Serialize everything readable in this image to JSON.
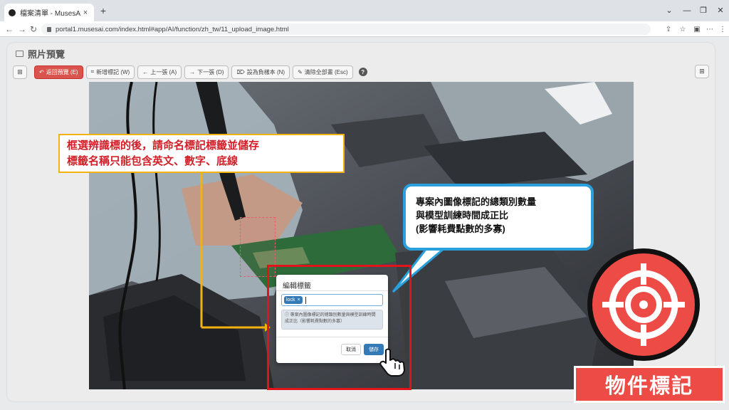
{
  "browser": {
    "tab_title": "檔案清單 - MusesAI",
    "tab_close": "×",
    "new_tab": "+",
    "url": "portal1.musesai.com/index.html#app/AI/function/zh_tw/11_upload_image.html",
    "window_controls": [
      "⌄",
      "—",
      "❐",
      "✕"
    ],
    "nav": [
      "←",
      "→",
      "↻"
    ],
    "right_icons": [
      "⇪",
      "☆",
      "▣",
      "⋯",
      "⋮"
    ]
  },
  "panel": {
    "title": "照片預覽"
  },
  "toolbar": {
    "left_square": "⊞",
    "back": "返回預覽 (E)",
    "new_label": "新增標記 (W)",
    "prev": "上一張 (A)",
    "next": "下一張 (D)",
    "set_negative": "設為負樣本 (N)",
    "clear_all": "清除全部畫 (Esc)",
    "help": "?",
    "right_square": "⊞"
  },
  "dialog": {
    "title": "編輯標籤",
    "tag": "lock",
    "tag_remove": "×",
    "info": "專案內圖像標記的總類別數量與模型訓練時間成正比（影響耗費點數的多寡）",
    "cancel": "取消",
    "save": "儲存"
  },
  "callouts": {
    "main_line1": "框選辨識標的後，請命名標記標籤並儲存",
    "main_line2": "標籤名稱只能包含英文、數字、底線",
    "note_line1": "專案內圖像標記的總類別數量",
    "note_line2": "與模型訓練時間成正比",
    "note_line3": "(影響耗費點數的多寡)"
  },
  "badge": {
    "label": "物件標記"
  },
  "colors": {
    "accent_red": "#e1141c",
    "callout_yellow": "#f2b312",
    "callout_blue": "#29a0dc",
    "primary_blue": "#337ab7",
    "badge_red": "#ec4c45"
  }
}
